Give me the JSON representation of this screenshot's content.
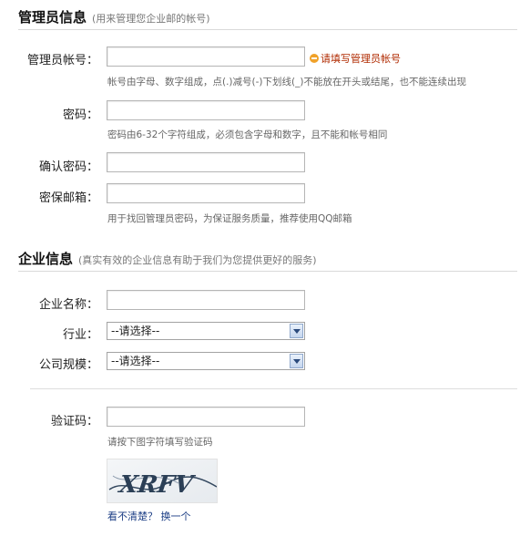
{
  "admin_section": {
    "title": "管理员信息",
    "subtitle": "(用来管理您企业邮的帐号)"
  },
  "admin_account": {
    "label": "管理员帐号：",
    "value": "",
    "warning": "请填写管理员帐号",
    "hint": "帐号由字母、数字组成，点(.)减号(-)下划线(_)不能放在开头或结尾，也不能连续出现"
  },
  "password": {
    "label": "密码：",
    "value": "",
    "hint": "密码由6-32个字符组成，必须包含字母和数字，且不能和帐号相同"
  },
  "confirm_password": {
    "label": "确认密码：",
    "value": ""
  },
  "security_email": {
    "label": "密保邮箱：",
    "value": "",
    "hint": "用于找回管理员密码，为保证服务质量，推荐使用QQ邮箱"
  },
  "company_section": {
    "title": "企业信息",
    "subtitle": "(真实有效的企业信息有助于我们为您提供更好的服务)"
  },
  "company_name": {
    "label": "企业名称：",
    "value": ""
  },
  "industry": {
    "label": "行业：",
    "selected": "--请选择--"
  },
  "company_size": {
    "label": "公司规模：",
    "selected": "--请选择--"
  },
  "verification": {
    "label": "验证码：",
    "value": "",
    "hint": "请按下图字符填写验证码",
    "captcha_text": "XRFV",
    "cant_see": "看不清楚？",
    "refresh": "换一个"
  },
  "colors": {
    "warning_text": "#b02a00",
    "warning_icon": "#f0a22a",
    "link": "#1c3e85"
  }
}
